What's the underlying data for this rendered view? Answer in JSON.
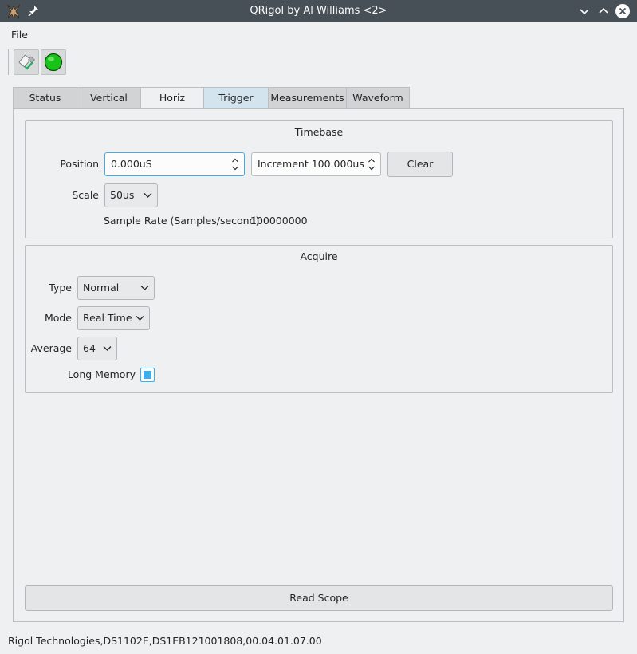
{
  "window": {
    "title": "QRigol by Al Williams <2>"
  },
  "menu": {
    "items": [
      "File"
    ]
  },
  "toolbar": {
    "buttons": [
      {
        "name": "disconnect",
        "icon": "usb-plug-check-icon"
      },
      {
        "name": "run-status",
        "icon": "green-led-icon",
        "color": "#18c218"
      }
    ]
  },
  "tabs": [
    {
      "label": "Status"
    },
    {
      "label": "Vertical"
    },
    {
      "label": "Horiz",
      "active": true
    },
    {
      "label": "Trigger"
    },
    {
      "label": "Measurements"
    },
    {
      "label": "Waveform"
    }
  ],
  "timebase": {
    "title": "Timebase",
    "position_label": "Position",
    "position_value": "0.000uS",
    "increment_value": "Increment 100.000us",
    "clear_label": "Clear",
    "scale_label": "Scale",
    "scale_value": "50us",
    "sample_rate_label": "Sample Rate (Samples/second):",
    "sample_rate_value": "100000000"
  },
  "acquire": {
    "title": "Acquire",
    "type_label": "Type",
    "type_value": "Normal",
    "mode_label": "Mode",
    "mode_value": "Real Time",
    "average_label": "Average",
    "average_value": "64",
    "long_memory_label": "Long Memory",
    "long_memory_checked": true
  },
  "read_scope_label": "Read Scope",
  "status_text": "Rigol Technologies,DS1102E,DS1EB121001808,00.04.01.07.00",
  "colors": {
    "accent": "#3daee9",
    "titlebar": "#475057"
  }
}
